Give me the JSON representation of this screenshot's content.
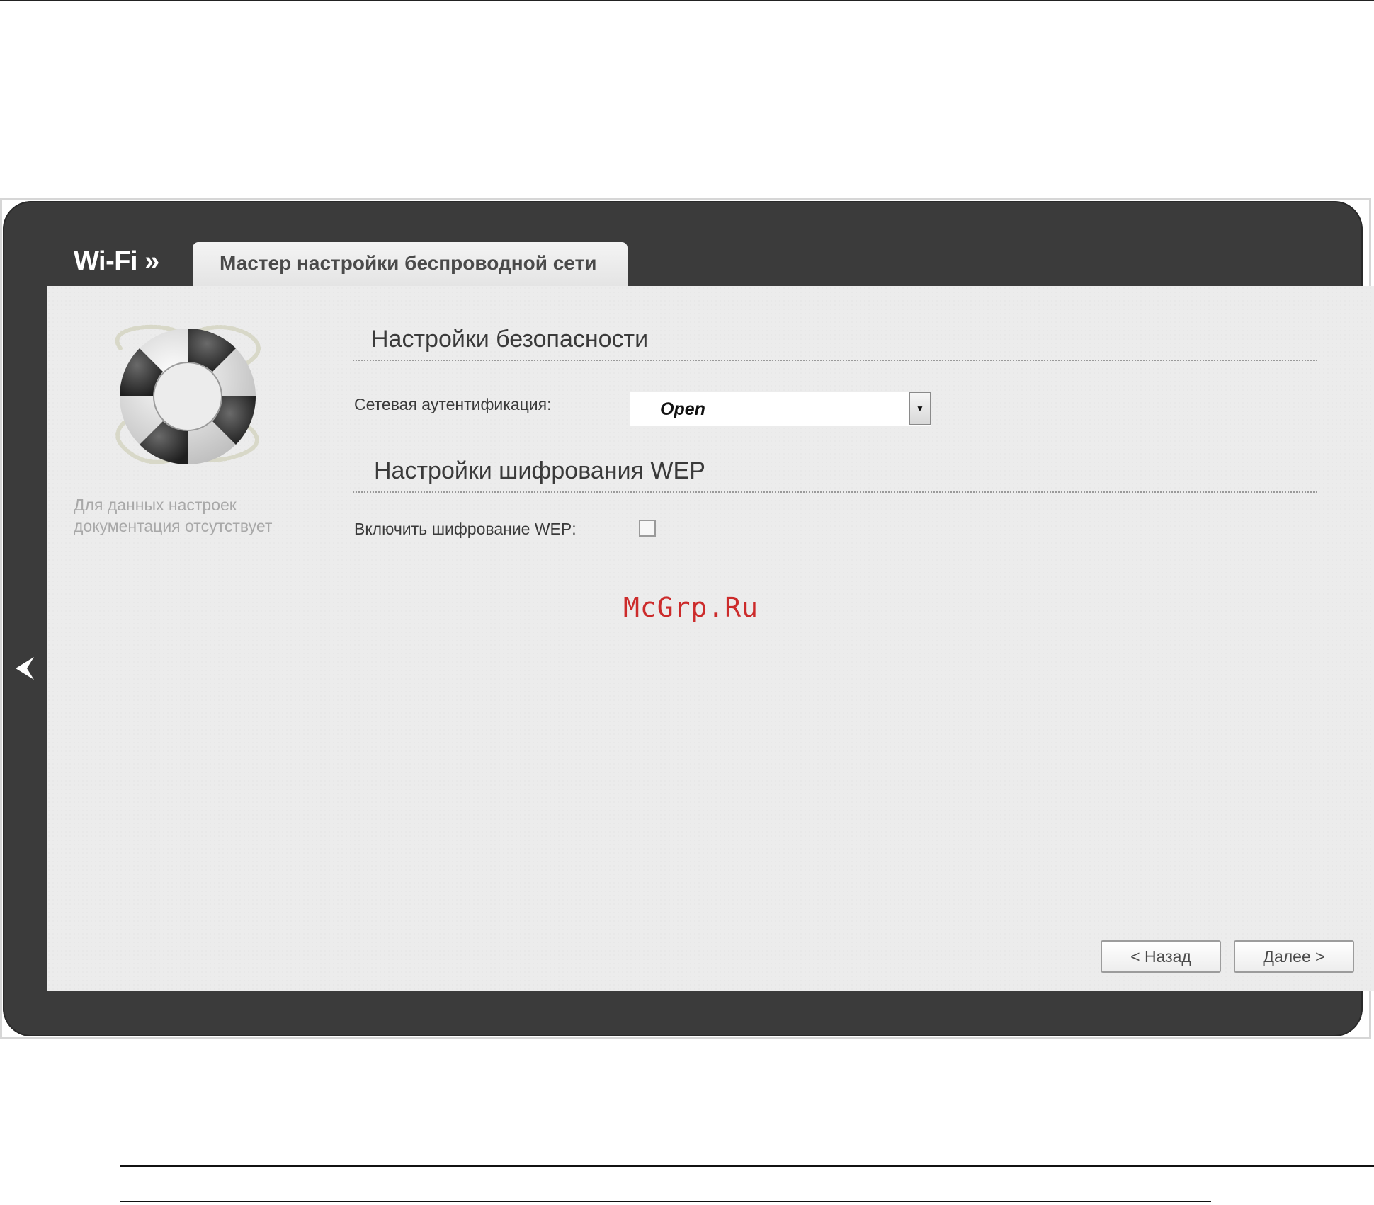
{
  "header": {
    "brand": "Wi-Fi »",
    "active_tab": "Мастер настройки беспроводной сети"
  },
  "sidebar": {
    "help_line1": "Для данных настроек",
    "help_line2": "документация отсутствует",
    "help_icon": "lifebuoy-icon"
  },
  "security": {
    "title": "Настройки безопасности",
    "auth_label": "Сетевая аутентификация:",
    "auth_value": "Open"
  },
  "wep": {
    "title": "Настройки шифрования WEP",
    "enable_label": "Включить шифрование WEP:",
    "enabled": false
  },
  "watermark": "McGrp.Ru",
  "buttons": {
    "back": "< Назад",
    "next": "Далее >"
  },
  "colors": {
    "frame": "#3b3b3b",
    "content_bg": "#ececec",
    "watermark": "#cc2b2b"
  }
}
